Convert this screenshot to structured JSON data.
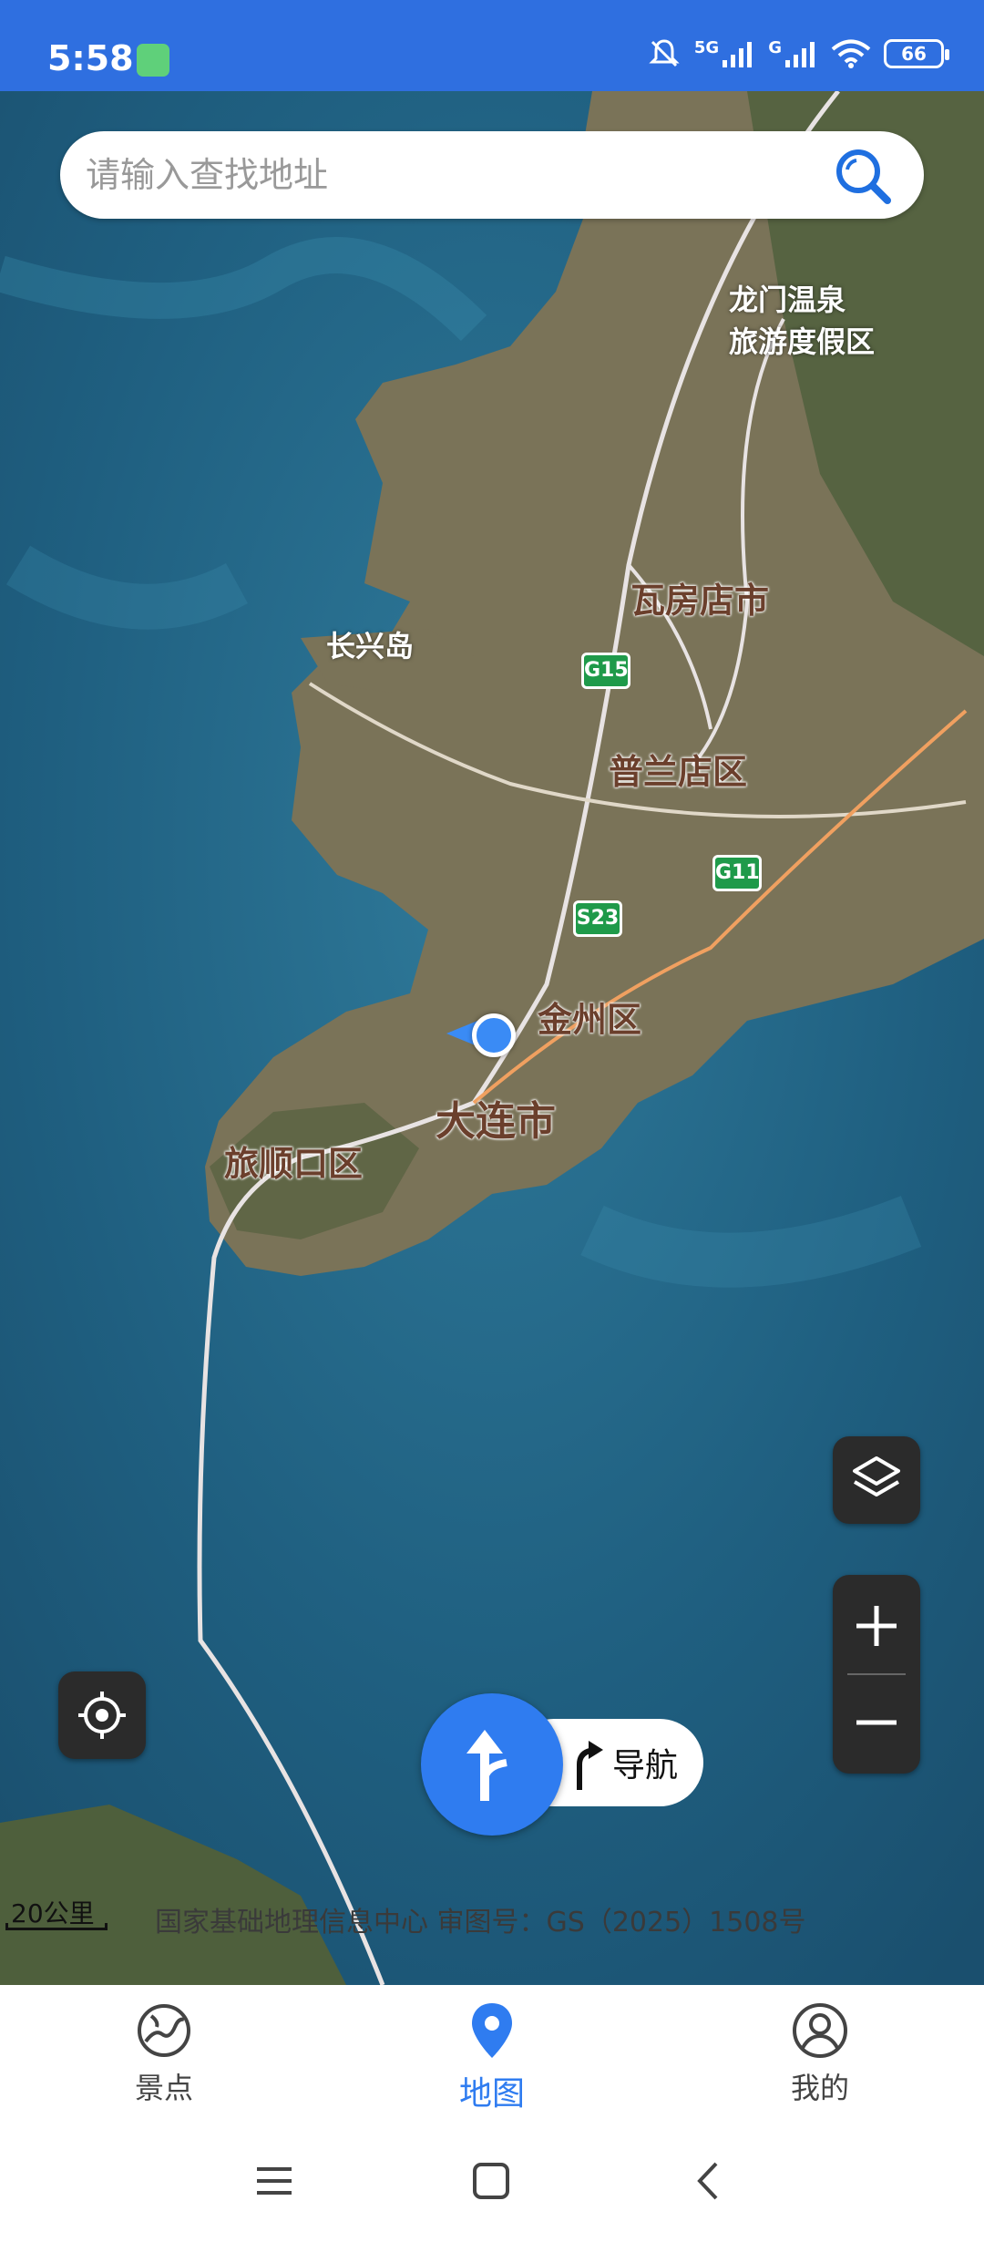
{
  "status_bar": {
    "time": "5:58",
    "network_primary": "5G",
    "network_secondary": "G",
    "battery": "66"
  },
  "search": {
    "placeholder": "请输入查找地址",
    "icon": "search-icon"
  },
  "map": {
    "places": {
      "longmen": [
        "龙门温泉",
        "旅游度假区"
      ],
      "wafangdian": "瓦房店市",
      "changxing": "长兴岛",
      "pulandian": "普兰店区",
      "jinzhou": "金州区",
      "dalian": "大连市",
      "lushun": "旅顺口区"
    },
    "highways": {
      "g15": "G15",
      "g11": "G11",
      "s23": "S23"
    },
    "scale": "20公里",
    "copyright": "国家基础地理信息中心 审图号：GS（2025）1508号"
  },
  "controls": {
    "layers_icon": "layers-icon",
    "zoom_in_icon": "plus-icon",
    "zoom_out_icon": "minus-icon",
    "locate_icon": "crosshair-icon",
    "navigate_label": "导航"
  },
  "tabs": [
    {
      "label": "景点",
      "icon": "globe-icon",
      "active": false
    },
    {
      "label": "地图",
      "icon": "map-pin-icon",
      "active": true
    },
    {
      "label": "我的",
      "icon": "user-icon",
      "active": false
    }
  ],
  "colors": {
    "status_bar": "#2f6fe0",
    "accent": "#2f7cf0",
    "sea": "#1f5f7f",
    "land": "#7a7358",
    "highway_shield": "#1f9a4a"
  }
}
